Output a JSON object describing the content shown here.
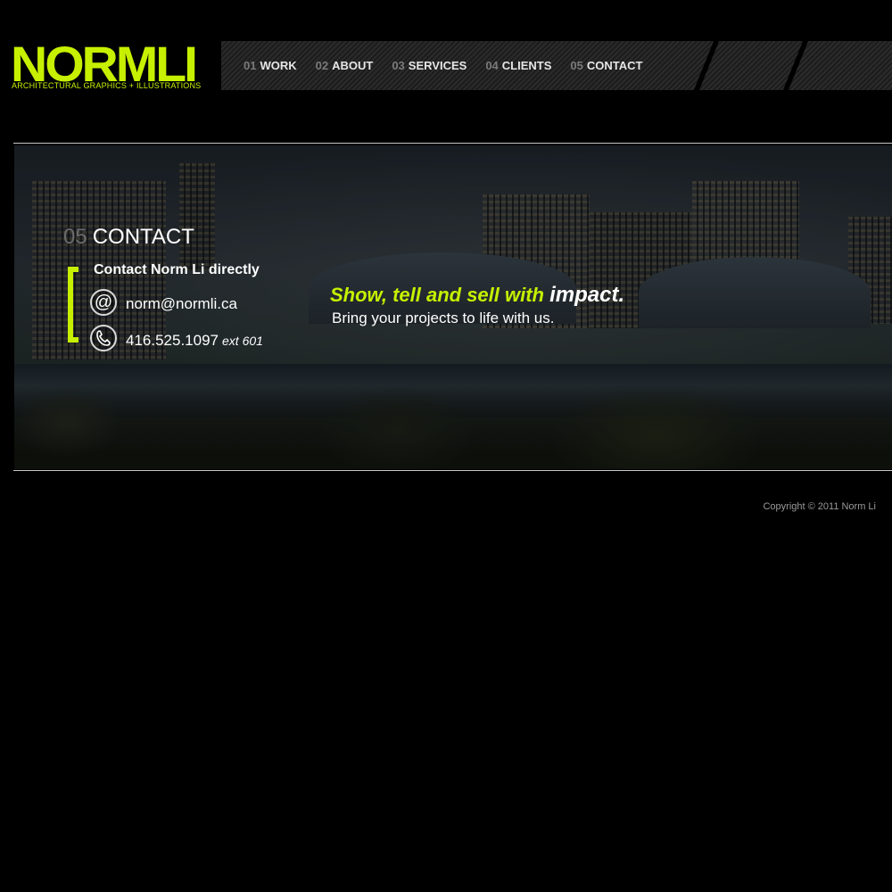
{
  "logo": {
    "name_part1": "NORM",
    "name_part2": "LI",
    "tagline": "ARCHITECTURAL GRAPHICS + ILLUSTRATIONS"
  },
  "nav": {
    "items": [
      {
        "num": "01",
        "label": "WORK"
      },
      {
        "num": "02",
        "label": "ABOUT"
      },
      {
        "num": "03",
        "label": "SERVICES"
      },
      {
        "num": "04",
        "label": "CLIENTS"
      },
      {
        "num": "05",
        "label": "CONTACT"
      }
    ]
  },
  "section": {
    "num": "05",
    "title": "CONTACT"
  },
  "contact": {
    "heading": "Contact Norm Li directly",
    "email": "norm@normli.ca",
    "phone": "416.525.1097",
    "ext": "ext 601",
    "email_icon": "at-icon",
    "phone_icon": "phone-icon"
  },
  "hero": {
    "tagline_part1": "Show, tell and sell with",
    "tagline_part2": "impact.",
    "subline": "Bring your projects to life with us."
  },
  "footer": {
    "copyright": "Copyright © 2011 Norm Li"
  },
  "colors": {
    "accent": "#c6f000",
    "background": "#000000"
  }
}
